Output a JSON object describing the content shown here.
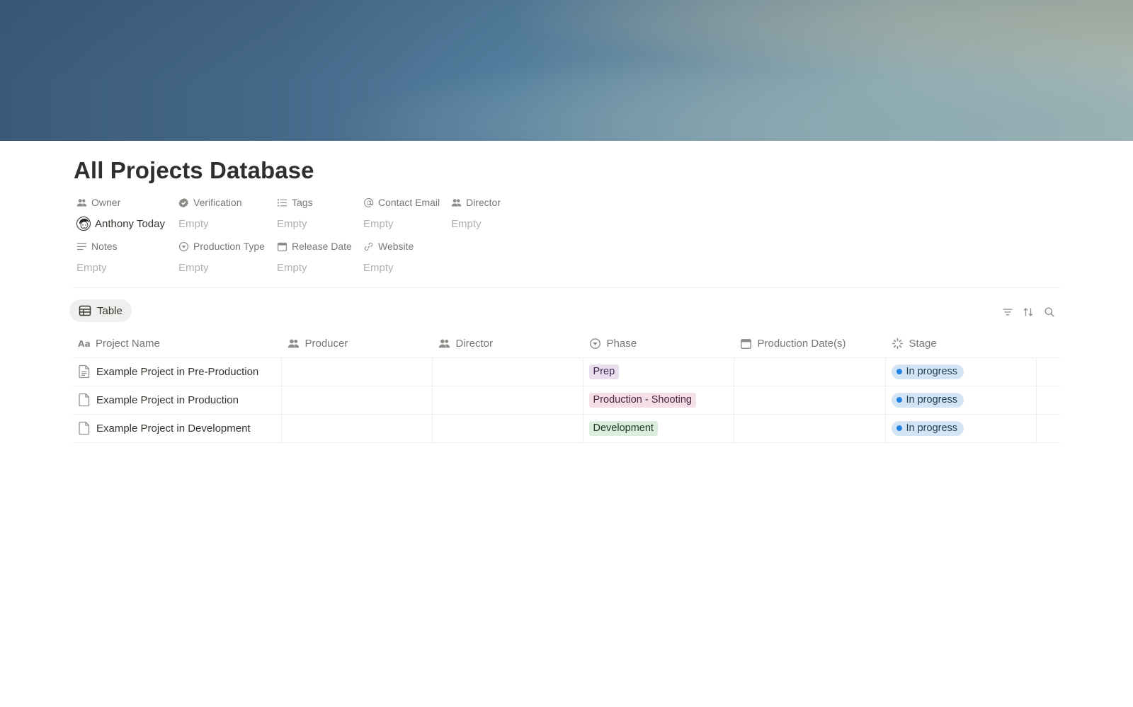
{
  "page": {
    "title": "All Projects Database"
  },
  "properties": [
    {
      "label": "Owner",
      "icon": "people-icon",
      "value": "Anthony Today",
      "filled": true
    },
    {
      "label": "Verification",
      "icon": "verified-badge-icon",
      "value": "Empty",
      "filled": false
    },
    {
      "label": "Tags",
      "icon": "list-icon",
      "value": "Empty",
      "filled": false
    },
    {
      "label": "Contact Email",
      "icon": "at-sign-icon",
      "value": "Empty",
      "filled": false
    },
    {
      "label": "Director",
      "icon": "people-icon",
      "value": "Empty",
      "filled": false
    },
    {
      "label": "Notes",
      "icon": "text-lines-icon",
      "value": "Empty",
      "filled": false
    },
    {
      "label": "Production Type",
      "icon": "select-circle-icon",
      "value": "Empty",
      "filled": false
    },
    {
      "label": "Release Date",
      "icon": "calendar-icon",
      "value": "Empty",
      "filled": false
    },
    {
      "label": "Website",
      "icon": "link-icon",
      "value": "Empty",
      "filled": false
    }
  ],
  "view": {
    "tab_label": "Table",
    "tab_icon": "table-icon",
    "tools": [
      "filter-icon",
      "sort-icon",
      "search-icon"
    ]
  },
  "table": {
    "columns": [
      {
        "label": "Project Name",
        "icon": "text-aa-icon"
      },
      {
        "label": "Producer",
        "icon": "people-icon"
      },
      {
        "label": "Director",
        "icon": "people-icon"
      },
      {
        "label": "Phase",
        "icon": "select-circle-icon"
      },
      {
        "label": "Production Date(s)",
        "icon": "calendar-icon"
      },
      {
        "label": "Stage",
        "icon": "status-spinner-icon"
      }
    ],
    "rows": [
      {
        "name": "Example Project in Pre-Production",
        "producer": "",
        "director": "",
        "phase": "Prep",
        "date": "",
        "stage": "In progress"
      },
      {
        "name": "Example Project in Production",
        "producer": "",
        "director": "",
        "phase": "Production - Shooting",
        "date": "",
        "stage": "In progress"
      },
      {
        "name": "Example Project in Development",
        "producer": "",
        "director": "",
        "phase": "Development",
        "date": "",
        "stage": "In progress"
      }
    ]
  },
  "colors": {
    "phase_prep_bg": "#e8deee",
    "phase_prep_fg": "#412454",
    "phase_production_bg": "#f5e0e9",
    "phase_production_fg": "#4c2337",
    "phase_development_bg": "#dbeddb",
    "phase_development_fg": "#1c3829",
    "status_bg": "#d3e5f5",
    "status_dot": "#2383e2"
  }
}
